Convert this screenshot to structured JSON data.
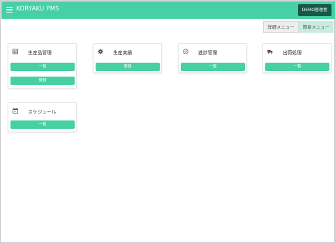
{
  "header": {
    "app_title": "KORYAKU PMS",
    "user_button": "DEMO管理者"
  },
  "menu_toggle": {
    "detail_label": "詳細メニュー",
    "simple_label": "簡易メニュー",
    "active": "simple"
  },
  "cards": {
    "products": {
      "title": "生産品管理",
      "icon": "grid-icon",
      "buttons": [
        "一覧",
        "登録"
      ]
    },
    "results": {
      "title": "生産実績",
      "icon": "gear-icon",
      "buttons": [
        "登録"
      ]
    },
    "progress": {
      "title": "進捗管理",
      "icon": "clock-check-icon",
      "buttons": [
        "一覧"
      ]
    },
    "shipping": {
      "title": "出荷処理",
      "icon": "truck-icon",
      "buttons": [
        "一覧"
      ]
    },
    "schedule": {
      "title": "スケジュール",
      "icon": "calendar-icon",
      "buttons": [
        "一覧"
      ]
    }
  },
  "colors": {
    "brand": "#46d0a4",
    "dark": "#155a49",
    "active_toggle": "#c7ece0"
  }
}
